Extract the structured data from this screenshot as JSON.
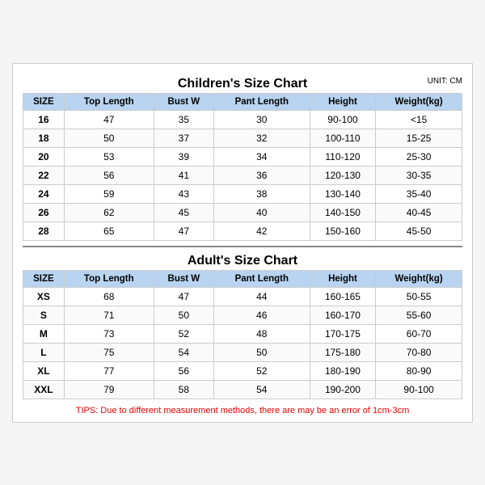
{
  "page": {
    "children_title": "Children's Size Chart",
    "adult_title": "Adult's Size Chart",
    "unit": "UNIT: CM",
    "headers": [
      "SIZE",
      "Top Length",
      "Bust W",
      "Pant Length",
      "Height",
      "Weight(kg)"
    ],
    "children_rows": [
      [
        "16",
        "47",
        "35",
        "30",
        "90-100",
        "<15"
      ],
      [
        "18",
        "50",
        "37",
        "32",
        "100-110",
        "15-25"
      ],
      [
        "20",
        "53",
        "39",
        "34",
        "110-120",
        "25-30"
      ],
      [
        "22",
        "56",
        "41",
        "36",
        "120-130",
        "30-35"
      ],
      [
        "24",
        "59",
        "43",
        "38",
        "130-140",
        "35-40"
      ],
      [
        "26",
        "62",
        "45",
        "40",
        "140-150",
        "40-45"
      ],
      [
        "28",
        "65",
        "47",
        "42",
        "150-160",
        "45-50"
      ]
    ],
    "adult_rows": [
      [
        "XS",
        "68",
        "47",
        "44",
        "160-165",
        "50-55"
      ],
      [
        "S",
        "71",
        "50",
        "46",
        "160-170",
        "55-60"
      ],
      [
        "M",
        "73",
        "52",
        "48",
        "170-175",
        "60-70"
      ],
      [
        "L",
        "75",
        "54",
        "50",
        "175-180",
        "70-80"
      ],
      [
        "XL",
        "77",
        "56",
        "52",
        "180-190",
        "80-90"
      ],
      [
        "XXL",
        "79",
        "58",
        "54",
        "190-200",
        "90-100"
      ]
    ],
    "tips": "TIPS: Due to different measurement methods, there are may be an error of 1cm-3cm"
  }
}
